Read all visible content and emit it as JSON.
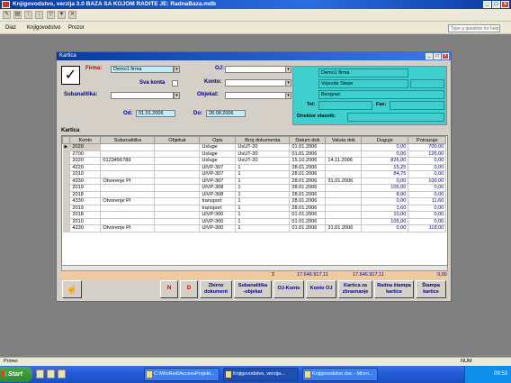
{
  "window": {
    "title": "Knjigovodstvo, verzija 3.0      BAZA SA KOJOM RADITE JE: RadnaBaza.mdb"
  },
  "menu": {
    "items": [
      "Diaz",
      "Knjigovodstvo",
      "Prozor"
    ],
    "help_placeholder": "Type a question for help"
  },
  "form": {
    "title": "Kartica",
    "labels": {
      "firma": "Firma:",
      "oj": "OJ:",
      "sva_konta": "Sva konta",
      "konto": "Konto:",
      "subanalitika": "Subanalitika:",
      "objekat": "Objekat:",
      "od": "Od:",
      "do": "Do:",
      "tel": "Tel:",
      "fax": "Fax:",
      "direktor": "Direktor vlasnik:",
      "kartica": "Kartica"
    },
    "values": {
      "firma": "Demo1 firma",
      "od": "01.01.2006",
      "do": "28.08.2006"
    },
    "company": {
      "name": "Demo1 firma",
      "street": "Vojvode Stepe",
      "city": "Beograd"
    }
  },
  "table": {
    "columns": [
      "Konto",
      "Subanalitika",
      "Objekat",
      "Opis",
      "Broj dokumenta",
      "Datum dok",
      "Valuta dok",
      "Duguje",
      "Potrazuje"
    ],
    "rows": [
      [
        "2020",
        "",
        "",
        "Usluge",
        "UsUT-20",
        "01.01.2006",
        "",
        "0,00",
        "700,00"
      ],
      [
        "2700",
        "",
        "",
        "Usluge",
        "UsUT-20",
        "01.01.2006",
        "",
        "0,00",
        "126,00"
      ],
      [
        "2020",
        "0123456789",
        "",
        "Usluge",
        "UsUT-20",
        "15.10.2006",
        "14.11.2006",
        "826,00",
        "0,00"
      ],
      [
        "4220",
        "",
        "",
        "UlVP-307",
        "1",
        "28.01.2006",
        "",
        "15,25",
        "0,00"
      ],
      [
        "1010",
        "",
        "",
        "UlVP-307",
        "1",
        "28.01.2006",
        "",
        "84,75",
        "0,00"
      ],
      [
        "4330",
        "Otvorenje PI",
        "",
        "UlVP-307",
        "1",
        "28.01.2006",
        "31.01.2006",
        "0,00",
        "100,00"
      ],
      [
        "2019",
        "",
        "",
        "UlVP-308",
        "1",
        "28.01.2006",
        "",
        "105,00",
        "0,00"
      ],
      [
        "2018",
        "",
        "",
        "UlVP-308",
        "1",
        "28.01.2006",
        "",
        "8,00",
        "0,00"
      ],
      [
        "4330",
        "Otvorenje PI",
        "",
        "transport",
        "1",
        "28.01.2006",
        "",
        "0,00",
        "11,60"
      ],
      [
        "2019",
        "",
        "",
        "transport",
        "1",
        "28.01.2006",
        "",
        "1,60",
        "0,00"
      ],
      [
        "2018",
        "",
        "",
        "UlVP-300",
        "1",
        "01.01.2006",
        "",
        "10,00",
        "0,00"
      ],
      [
        "2010",
        "",
        "",
        "UlVP-300",
        "1",
        "01.01.2006",
        "",
        "105,00",
        "0,00"
      ],
      [
        "4330",
        "Otvorenje PI",
        "",
        "UlVP-300",
        "1",
        "01.01.2006",
        "31.01.2006",
        "0,00",
        "118,00"
      ]
    ]
  },
  "totals": {
    "sigma": "Σ",
    "duguje": "17.646.917,11",
    "potrazuje": "17.646.917,11",
    "saldo": "0,00"
  },
  "buttons": {
    "n": "N",
    "d": "D",
    "zbirno": "Zbirno\ndokument",
    "subanalitika": "Subanalitika\n-objekat",
    "oj_konto": "OJ-Konto",
    "konto_oj": "Konto OJ",
    "kartica_zatvaranje": "Kartica za\nzbravnanje",
    "radna_stampa": "Radna štampa\nkartice",
    "stampa": "Štampa\nkartice"
  },
  "status": {
    "left": "Primer",
    "right": "NUM"
  },
  "taskbar": {
    "start": "Start",
    "tasks": [
      "C:\\WinRed\\AccessProjekt...",
      "Knjigovodstvo, verzija...",
      "Knjigovodstvo.doc - Micro..."
    ],
    "clock": "09:53"
  }
}
